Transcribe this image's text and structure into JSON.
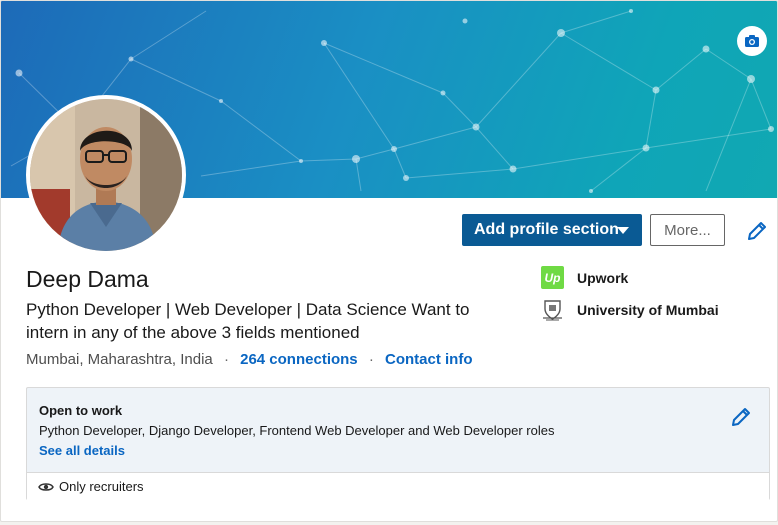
{
  "profile": {
    "name": "Deep Dama",
    "headline": "Python Developer | Web Developer | Data Science Want to intern in any of the above 3 fields mentioned",
    "location": "Mumbai, Maharashtra, India",
    "separator": "·",
    "connections": "264 connections",
    "contact_info": "Contact info"
  },
  "actions": {
    "add_section": "Add profile section",
    "more": "More..."
  },
  "organizations": [
    {
      "name": "Upwork",
      "logo_text": "Up",
      "icon": "upwork-logo"
    },
    {
      "name": "University of Mumbai",
      "icon": "university-crest-logo"
    }
  ],
  "open_to_work": {
    "title": "Open to work",
    "roles": "Python Developer, Django Developer, Frontend Web Developer and Web Developer roles",
    "link": "See all details",
    "visibility": "Only recruiters"
  },
  "icons": {
    "camera": "camera-icon",
    "pencil": "pencil-icon",
    "eye": "eye-icon",
    "caret": "caret-down-icon"
  },
  "colors": {
    "primary_button": "#0a5a94",
    "link": "#0a66c2",
    "banner_start": "#1d6ab8",
    "banner_end": "#11a8b2",
    "upwork_green": "#6fda44"
  }
}
